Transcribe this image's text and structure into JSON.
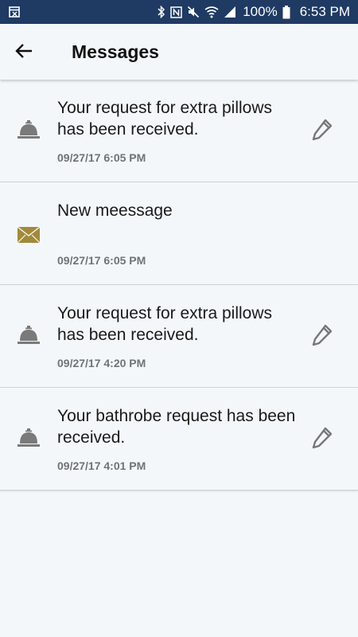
{
  "status_bar": {
    "battery_percent": "100%",
    "time": "6:53 PM",
    "icons": [
      "calendar-icon",
      "bluetooth-icon",
      "nfc-icon",
      "mute-icon",
      "wifi-icon",
      "signal-icon",
      "battery-icon"
    ]
  },
  "app_bar": {
    "back_icon": "arrow-left-icon",
    "title": "Messages"
  },
  "colors": {
    "status_bar": "#1f3a63",
    "background": "#f4f7fa",
    "bell_icon": "#7a7a7a",
    "envelope_icon": "#a28a3a",
    "timestamp": "#6f7378"
  },
  "messages": [
    {
      "icon": "service-bell-icon",
      "text": "Your request for extra pillows has been received.",
      "timestamp": "09/27/17 6:05 PM",
      "editable": true
    },
    {
      "icon": "envelope-icon",
      "text": "New meessage",
      "timestamp": "09/27/17 6:05 PM",
      "editable": false
    },
    {
      "icon": "service-bell-icon",
      "text": "Your request for extra pillows has been received.",
      "timestamp": "09/27/17 4:20 PM",
      "editable": true
    },
    {
      "icon": "service-bell-icon",
      "text": "Your bathrobe request has been received.",
      "timestamp": "09/27/17 4:01 PM",
      "editable": true
    }
  ]
}
